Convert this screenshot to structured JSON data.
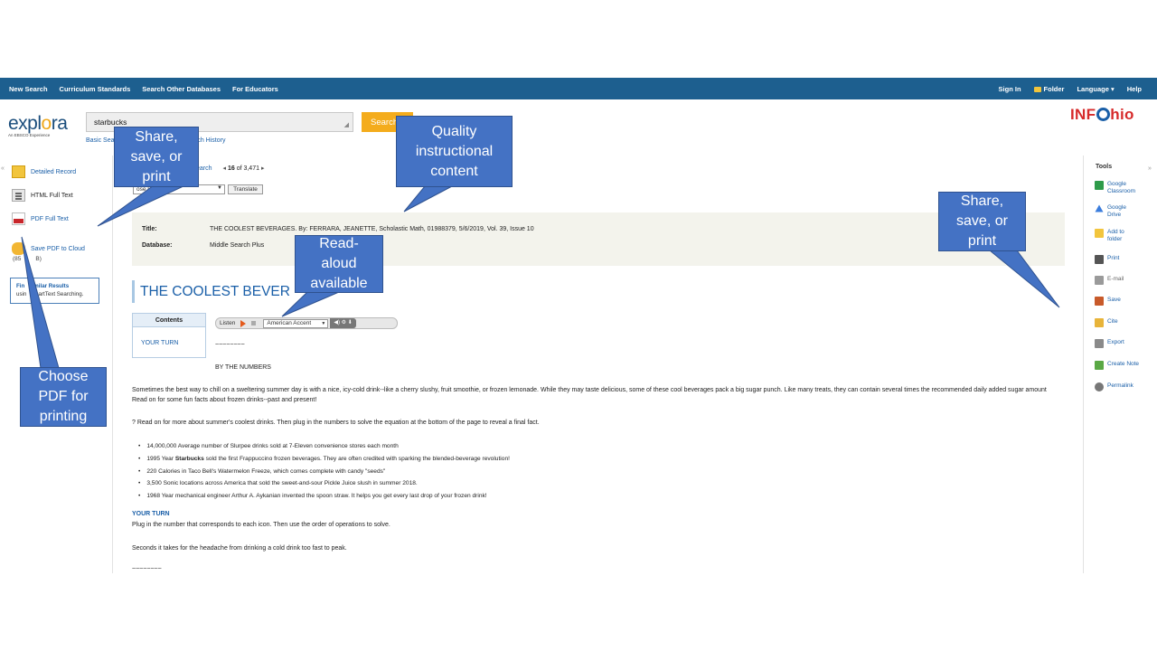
{
  "topnav": {
    "left": [
      "New Search",
      "Curriculum Standards",
      "Search Other Databases",
      "For Educators"
    ],
    "sign_in": "Sign In",
    "folder": "Folder",
    "language": "Language ▾",
    "help": "Help"
  },
  "header": {
    "logo_main_a": "expl",
    "logo_main_o": "o",
    "logo_main_b": "ra",
    "logo_sub": "An EBSCO Experience",
    "search_value": "starbucks",
    "search_button": "Search",
    "basic_search": "Basic Sea",
    "search_history": "rch History",
    "partner_a": "INF",
    "partner_b": "hio"
  },
  "leftnav": {
    "detailed_record": "Detailed Record",
    "html_full_text": "HTML Full Text",
    "pdf_full_text": "PDF Full Text",
    "save_pdf_cloud": "Save PDF to Cloud",
    "size_note": "(85",
    "size_note_b": "B)",
    "similar_title": "Fin",
    "similar_title_b": "milar Results",
    "similar_body_a": "usin",
    "similar_body_b": "martText Searching."
  },
  "result_nav": {
    "back": "earch",
    "position": "16",
    "of_total": "of 3,471",
    "language_select": "ose Language",
    "translate": "Translate"
  },
  "record": {
    "title_label": "Title:",
    "title_value": "THE COOLEST BEVERAGES. By: FERRARA, JEANETTE, Scholastic Math, 01988379, 5/6/2019, Vol. 39, Issue 10",
    "database_label": "Database:",
    "database_value": "Middle Search Plus",
    "article_title": "THE COOLEST BEVER"
  },
  "contents": {
    "header": "Contents",
    "item": "YOUR TURN"
  },
  "read_aloud": {
    "listen": "Listen",
    "accent": "American Accent"
  },
  "article": {
    "tilde": "~~~~~~~~",
    "by_the_numbers": "BY THE NUMBERS",
    "p1": "Sometimes the best way to chill on a sweltering summer day is with a nice, icy-cold drink--like a cherry slushy, fruit smoothie, or frozen lemonade. While they may taste delicious, some of these cool beverages pack a big sugar punch. Like many treats, they can contain several times the recommended daily added sugar amount Read on for some fun facts about frozen drinks--past and present!",
    "p2": "? Read on for more about summer's coolest drinks. Then plug in the numbers to solve the equation at the bottom of the page to reveal a final fact.",
    "bullets": [
      "14,000,000 Average number of Slurpee drinks sold at 7-Eleven convenience stores each month",
      "1995 Year Starbucks sold the first Frappuccino frozen beverages. They are often credited with sparking the blended-beverage revolution!",
      "220 Calories in Taco Bell's Watermelon Freeze, which comes complete with candy \"seeds\"",
      "3,500 Sonic locations across America that sold the sweet-and-sour Pickle Juice slush in summer 2018.",
      "1968 Year mechanical engineer Arthur A. Aykanian invented the spoon straw. It helps you get every last drop of your frozen drink!"
    ],
    "your_turn": "YOUR TURN",
    "p3": "Plug in the number that corresponds to each icon. Then use the order of operations to solve.",
    "p4": "Seconds it takes for the headache from drinking a cold drink too fast to peak.",
    "tilde_end": "~~~~~~~~"
  },
  "tools": {
    "header": "Tools",
    "items": [
      {
        "label": "Google Classroom",
        "icon": "google-classroom-icon",
        "color": "#2e9b4a"
      },
      {
        "label": "Google Drive",
        "icon": "google-drive-icon",
        "color": "#3b7ddd"
      },
      {
        "label": "Add to folder",
        "icon": "folder-icon",
        "color": "#f2c53d"
      },
      {
        "label": "Print",
        "icon": "print-icon",
        "color": "#555555"
      },
      {
        "label": "E-mail",
        "icon": "email-icon",
        "color": "#9a9a9a"
      },
      {
        "label": "Save",
        "icon": "save-icon",
        "color": "#c85a2a"
      },
      {
        "label": "Cite",
        "icon": "cite-icon",
        "color": "#e8b43a"
      },
      {
        "label": "Export",
        "icon": "export-icon",
        "color": "#8a8a8a"
      },
      {
        "label": "Create Note",
        "icon": "note-icon",
        "color": "#5aa845"
      },
      {
        "label": "Permalink",
        "icon": "link-icon",
        "color": "#777777"
      }
    ]
  },
  "callouts": {
    "share_left": "Share,\nsave, or\nprint",
    "quality": "Quality\ninstructional\ncontent",
    "share_right": "Share,\nsave, or\nprint",
    "read_aloud": "Read-\naloud\navailable",
    "choose_pdf": "Choose\nPDF for\nprinting"
  },
  "colors": {
    "nav_bar": "#1d5f8f",
    "search_button": "#f4ac1c",
    "link": "#1a5fa8",
    "callout": "#4472c4",
    "partner_red": "#d62a2a"
  }
}
